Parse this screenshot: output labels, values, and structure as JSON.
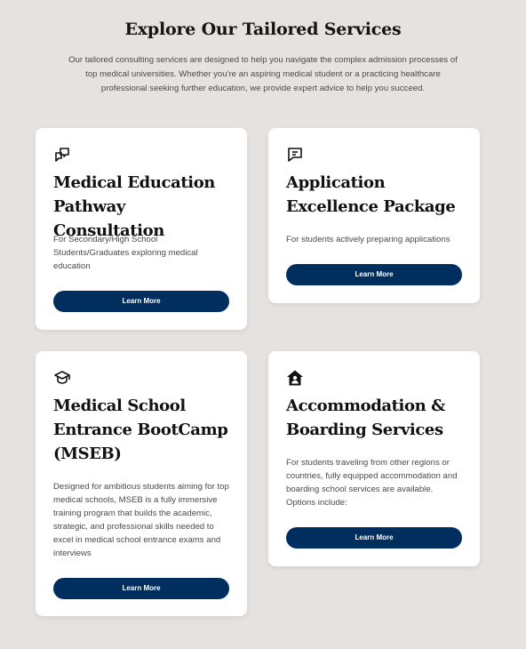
{
  "header": {
    "title": "Explore Our Tailored Services",
    "subtitle": "Our tailored consulting services are designed to help you navigate the complex admission processes of top medical universities. Whether you're an aspiring medical student or a practicing healthcare professional seeking further education, we provide expert advice to help you succeed."
  },
  "cards": [
    {
      "icon": "chat-bubbles-icon",
      "title": "Medical Education Pathway Consultation",
      "description": "For Secondary/High School Students/Graduates  exploring medical education",
      "button_label": "Learn More"
    },
    {
      "icon": "message-icon",
      "title": "Application Excellence Package",
      "description": "For students actively preparing applications",
      "button_label": "Learn More"
    },
    {
      "icon": "graduation-cap-icon",
      "title": "Medical School Entrance BootCamp (MSEB)",
      "description": "Designed for ambitious students aiming for top medical schools, MSEB is a fully immersive training program that builds the academic, strategic, and professional skills needed to excel in medical school entrance exams and interviews",
      "button_label": "Learn More"
    },
    {
      "icon": "house-user-icon",
      "title": "Accommodation & Boarding Services",
      "description": "For students traveling from other regions or countries, fully equipped accommodation and boarding school services are available. Options include:",
      "button_label": "Learn More"
    }
  ],
  "colors": {
    "background": "#e6e2e0",
    "card": "#ffffff",
    "button": "#002f5f"
  }
}
